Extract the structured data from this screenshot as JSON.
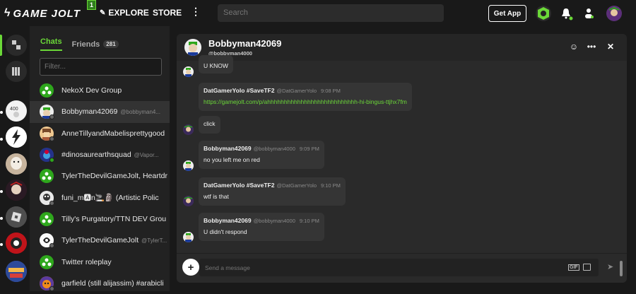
{
  "topbar": {
    "logo_text": "GAME JOLT",
    "badge": "1",
    "explore": "EXPLORE",
    "store": "STORE",
    "more": "⋮",
    "search_placeholder": "Search",
    "get_app": "Get App"
  },
  "sidebar": {
    "tabs": {
      "chats": "Chats",
      "friends": "Friends",
      "friends_count": "281"
    },
    "filter_placeholder": "Filter...",
    "chats": [
      {
        "name": "NekoX Dev Group",
        "handle": "",
        "group": true
      },
      {
        "name": "Bobbyman42069",
        "handle": "@bobbyman4...",
        "selected": true
      },
      {
        "name": "AnneTillyandMabelisprettygood",
        "handle": ""
      },
      {
        "name": "#dinosaurearthsquad",
        "handle": "@Vapor..."
      },
      {
        "name": "TylerTheDevilGameJolt, Heartdr",
        "handle": ""
      },
      {
        "name": "funi_m🅰n🚬🗿 (Artistic Polic",
        "handle": ""
      },
      {
        "name": "Tilly's Purgatory/TTN DEV Grou",
        "handle": "",
        "group": true
      },
      {
        "name": "TylerTheDevilGameJolt",
        "handle": "@TylerT..."
      },
      {
        "name": "Twitter roleplay",
        "handle": "",
        "group": true
      },
      {
        "name": "garfield (still alijassim) #arabicli",
        "handle": ""
      }
    ]
  },
  "chat": {
    "title": "Bobbyman42069",
    "handle": "@bobbyman4000",
    "messages": [
      {
        "author": "",
        "handle": "",
        "time": "",
        "text": "U KNOW"
      },
      {
        "author": "DatGamerYolo #SaveTF2",
        "handle": "@DatGamerYolo",
        "time": "9:08 PM",
        "text": "https://gamejolt.com/p/ahhhhhhhhhhhhhhhhhhhhhhhhhhh-hi-bingus-ttjhx7fm",
        "link": true
      },
      {
        "author": "",
        "handle": "",
        "time": "",
        "text": "click"
      },
      {
        "author": "Bobbyman42069",
        "handle": "@bobbyman4000",
        "time": "9:09 PM",
        "text": "no you left me on red"
      },
      {
        "author": "DatGamerYolo #SaveTF2",
        "handle": "@DatGamerYolo",
        "time": "9:10 PM",
        "text": "wtf is that"
      },
      {
        "author": "Bobbyman42069",
        "handle": "@bobbyman4000",
        "time": "9:10 PM",
        "text": "U didn't respond"
      }
    ],
    "composer": {
      "placeholder": "Send a message",
      "gif": "GIF"
    }
  },
  "colors": {
    "accent": "#6bd838",
    "group": "#2ea71c",
    "online": "#2ea71c"
  }
}
